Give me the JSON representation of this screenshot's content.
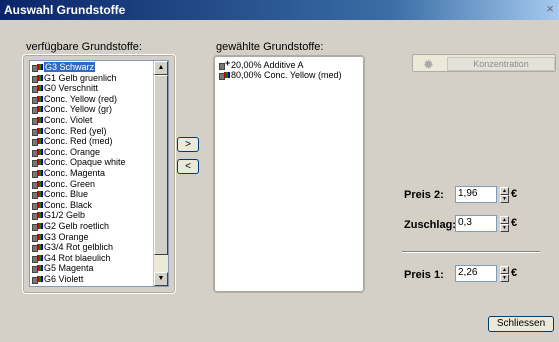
{
  "window": {
    "title": "Auswahl Grundstoffe",
    "close_glyph": "×"
  },
  "available": {
    "label": "verfügbare Grundstoffe:",
    "items": [
      {
        "label": "G3 Schwarz",
        "selected": true
      },
      {
        "label": "G1 Gelb gruenlich",
        "selected": false
      },
      {
        "label": "G0 Verschnitt",
        "selected": false
      },
      {
        "label": "Conc. Yellow (red)",
        "selected": false
      },
      {
        "label": "Conc. Yellow (gr)",
        "selected": false
      },
      {
        "label": "Conc. Violet",
        "selected": false
      },
      {
        "label": "Conc. Red (yel)",
        "selected": false
      },
      {
        "label": "Conc. Red (med)",
        "selected": false
      },
      {
        "label": "Conc. Orange",
        "selected": false
      },
      {
        "label": "Conc. Opaque white",
        "selected": false
      },
      {
        "label": "Conc. Magenta",
        "selected": false
      },
      {
        "label": "Conc. Green",
        "selected": false
      },
      {
        "label": "Conc. Blue",
        "selected": false
      },
      {
        "label": "Conc. Black",
        "selected": false
      },
      {
        "label": "G1/2 Gelb",
        "selected": false
      },
      {
        "label": "G2 Gelb roetlich",
        "selected": false
      },
      {
        "label": "G3 Orange",
        "selected": false
      },
      {
        "label": "G3/4 Rot gelblich",
        "selected": false
      },
      {
        "label": "G4 Rot blaeulich",
        "selected": false
      },
      {
        "label": "G5 Magenta",
        "selected": false
      },
      {
        "label": "G6 Violett",
        "selected": false
      }
    ]
  },
  "chosen": {
    "label": "gewählte Grundstoffe:",
    "items": [
      {
        "label": "20,00%  Additive A",
        "icon": "additive-icon"
      },
      {
        "label": "80,00%  Conc. Yellow (med)",
        "icon": "paint-can-icon"
      }
    ]
  },
  "transfer": {
    "add_label": ">",
    "remove_label": "<"
  },
  "concentration": {
    "label": "Konzentration",
    "icon": "gear-icon"
  },
  "prices": {
    "preis2_label": "Preis 2:",
    "preis2_value": "1,96",
    "zuschlag_label": "Zuschlag:",
    "zuschlag_value": "0,3",
    "preis1_label": "Preis 1:",
    "preis1_value": "2,26",
    "currency": "€"
  },
  "close_button": {
    "label": "Schliessen"
  },
  "colors": {
    "selection": "#316ac5",
    "dialog_bg": "#d4d0c8",
    "titlebar": "#0a246a"
  }
}
